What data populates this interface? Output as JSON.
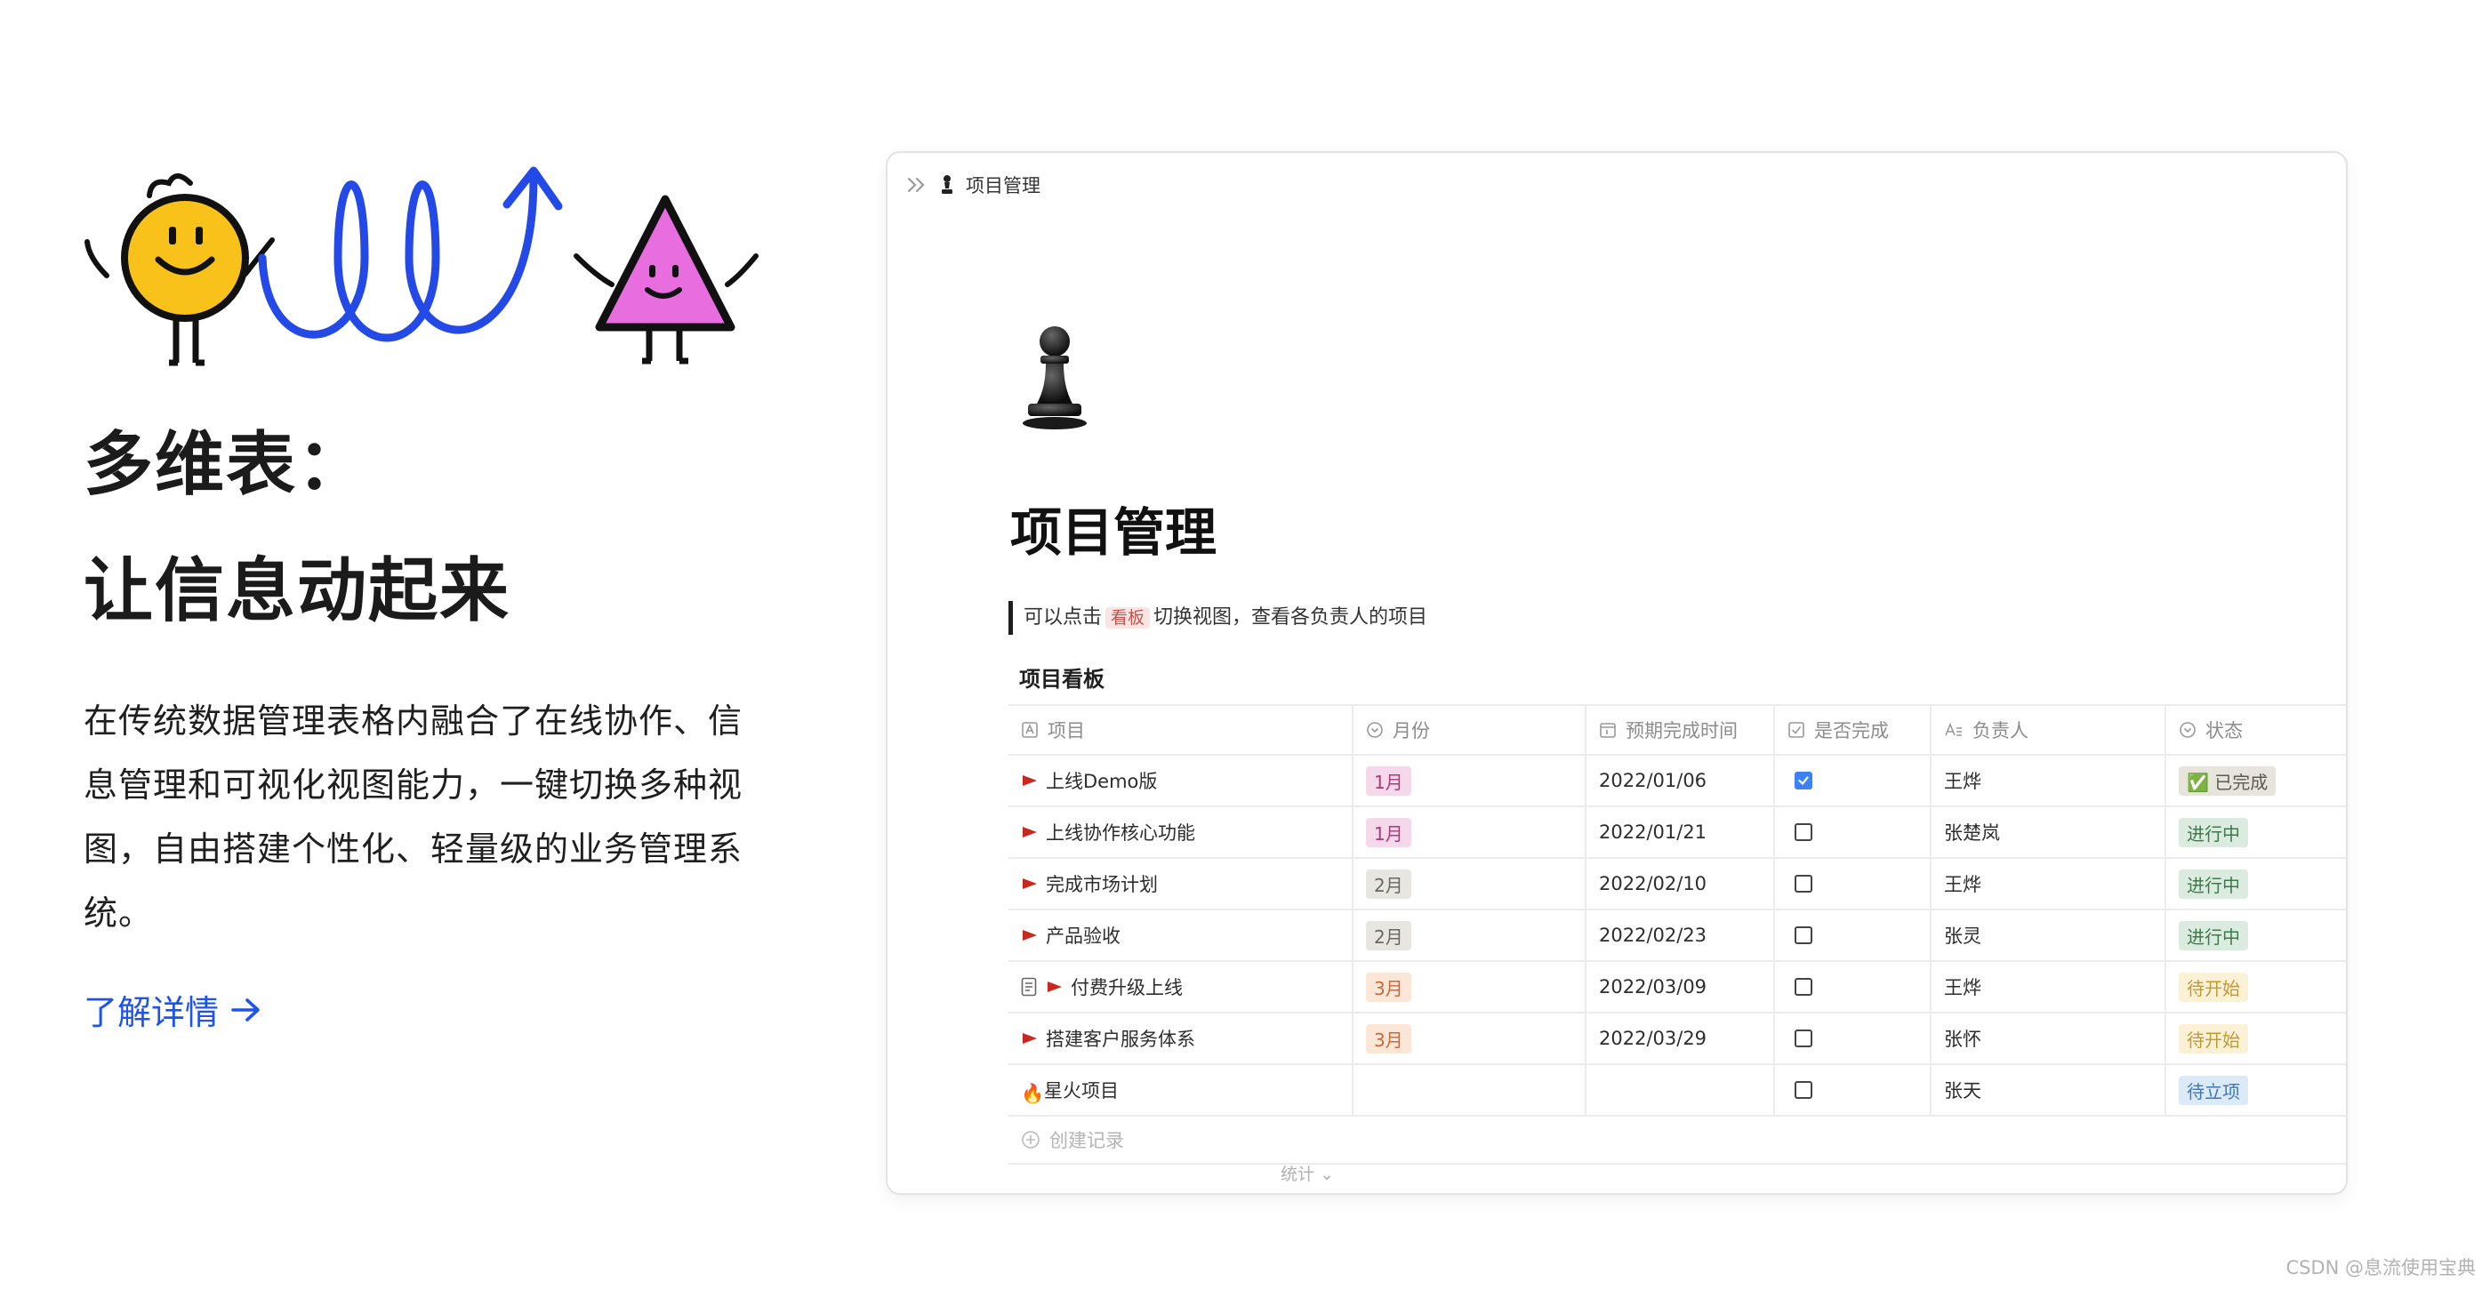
{
  "left": {
    "heading_line1": "多维表：",
    "heading_line2": "让信息动起来",
    "description": "在传统数据管理表格内融合了在线协作、信息管理和可视化视图能力，一键切换多种视图，自由搭建个性化、轻量级的业务管理系统。",
    "link_label": "了解详情",
    "link_color": "#1f55e6"
  },
  "window": {
    "breadcrumb_title": "项目管理",
    "page_icon": "chess-pawn-icon",
    "page_title": "项目管理",
    "callout_before": "可以点击",
    "callout_tag": "看板",
    "callout_after": "切换视图，查看各负责人的项目",
    "board_title": "项目看板",
    "columns": [
      "项目",
      "月份",
      "预期完成时间",
      "是否完成",
      "负责人",
      "状态"
    ],
    "rows": [
      {
        "name": "上线Demo版",
        "icon": "flag-icon",
        "month": "1月",
        "date": "2022/01/06",
        "done": true,
        "owner": "王烨",
        "status": "✅ 已完成",
        "month_bg": "#f5d9ea",
        "month_fg": "#a83a78",
        "status_bg": "#e7e4dc",
        "status_fg": "#5e5a4f"
      },
      {
        "name": "上线协作核心功能",
        "icon": "flag-icon",
        "month": "1月",
        "date": "2022/01/21",
        "done": false,
        "owner": "张楚岚",
        "status": "进行中",
        "month_bg": "#f5d9ea",
        "month_fg": "#a83a78",
        "status_bg": "#dcebdf",
        "status_fg": "#3c7a4c"
      },
      {
        "name": "完成市场计划",
        "icon": "flag-icon",
        "month": "2月",
        "date": "2022/02/10",
        "done": false,
        "owner": "王烨",
        "status": "进行中",
        "month_bg": "#e8e6e1",
        "month_fg": "#6c675e",
        "status_bg": "#dcebdf",
        "status_fg": "#3c7a4c"
      },
      {
        "name": "产品验收",
        "icon": "flag-icon",
        "month": "2月",
        "date": "2022/02/23",
        "done": false,
        "owner": "张灵",
        "status": "进行中",
        "month_bg": "#e8e6e1",
        "month_fg": "#6c675e",
        "status_bg": "#dcebdf",
        "status_fg": "#3c7a4c"
      },
      {
        "name": "付费升级上线",
        "icon": "flag-icon",
        "has_doc": true,
        "month": "3月",
        "date": "2022/03/09",
        "done": false,
        "owner": "王烨",
        "status": "待开始",
        "month_bg": "#fbe6d8",
        "month_fg": "#c8693a",
        "status_bg": "#fbf1d6",
        "status_fg": "#c49a30"
      },
      {
        "name": "搭建客户服务体系",
        "icon": "flag-icon",
        "month": "3月",
        "date": "2022/03/29",
        "done": false,
        "owner": "张怀",
        "status": "待开始",
        "month_bg": "#fbe6d8",
        "month_fg": "#c8693a",
        "status_bg": "#fbf1d6",
        "status_fg": "#c49a30"
      },
      {
        "name": "星火项目",
        "icon": "fire-icon",
        "month": "",
        "date": "",
        "done": false,
        "owner": "张天",
        "status": "待立项",
        "month_bg": "",
        "month_fg": "",
        "status_bg": "#dceaf8",
        "status_fg": "#3a78b8"
      }
    ],
    "create_label": "创建记录",
    "stats_label": "统计"
  },
  "watermark": "CSDN @息流使用宝典"
}
